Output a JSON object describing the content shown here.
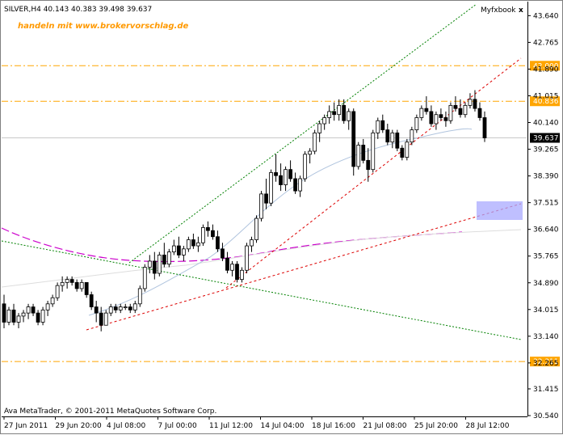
{
  "window": {
    "header": "SILVER,H4  40.143 40.383 39.498 39.637",
    "caption": "Myfxbook",
    "close_label": "x"
  },
  "watermark": "handeln mit www.brokervorschlag.de",
  "footer": "Ava MetaTrader, © 2001-2011 MetaQuotes Software Corp.",
  "chart_data": {
    "type": "candlestick",
    "symbol": "SILVER",
    "timeframe": "H4",
    "ohlc_last": [
      40.143,
      40.383,
      39.498,
      39.637
    ],
    "last_price": "39.637",
    "y_ticks": [
      "43.640",
      "42.765",
      "41.890",
      "41.015",
      "40.140",
      "39.265",
      "38.390",
      "37.515",
      "36.640",
      "35.765",
      "34.890",
      "34.015",
      "33.140",
      "32.265",
      "31.415",
      "30.540"
    ],
    "x_ticks": [
      "27 Jun 2011",
      "29 Jun 20:00",
      "4 Jul 08:00",
      "7 Jul 00:00",
      "11 Jul 12:00",
      "14 Jul 04:00",
      "18 Jul 16:00",
      "21 Jul 08:00",
      "25 Jul 20:00",
      "28 Jul 12:00"
    ],
    "ylim": [
      30.54,
      44.1
    ],
    "horizontal_levels": [
      {
        "value": 42.0,
        "label": "42.000",
        "color": "#ffa500"
      },
      {
        "value": 40.836,
        "label": "40.836",
        "color": "#ffa500"
      },
      {
        "value": 32.311,
        "label": "32.311",
        "color": "#ffa500"
      }
    ],
    "candles": [
      [
        34.2,
        34.5,
        33.4,
        33.6
      ],
      [
        33.6,
        34.1,
        33.5,
        34.0
      ],
      [
        34.0,
        34.2,
        33.5,
        33.6
      ],
      [
        33.6,
        33.9,
        33.4,
        33.8
      ],
      [
        33.8,
        34.0,
        33.6,
        33.9
      ],
      [
        33.9,
        34.2,
        33.7,
        34.1
      ],
      [
        34.1,
        34.2,
        33.8,
        33.9
      ],
      [
        33.9,
        34.0,
        33.5,
        33.6
      ],
      [
        33.6,
        34.1,
        33.5,
        34.0
      ],
      [
        34.0,
        34.3,
        33.8,
        34.2
      ],
      [
        34.2,
        34.5,
        34.1,
        34.4
      ],
      [
        34.4,
        34.9,
        34.3,
        34.8
      ],
      [
        34.8,
        35.1,
        34.6,
        34.9
      ],
      [
        34.9,
        35.1,
        34.7,
        35.0
      ],
      [
        35.0,
        35.1,
        34.8,
        34.9
      ],
      [
        34.9,
        35.0,
        34.6,
        34.7
      ],
      [
        34.7,
        35.0,
        34.6,
        34.9
      ],
      [
        34.9,
        34.9,
        34.4,
        34.5
      ],
      [
        34.5,
        34.6,
        34.0,
        34.1
      ],
      [
        34.1,
        34.3,
        33.6,
        33.9
      ],
      [
        33.9,
        34.1,
        33.3,
        33.5
      ],
      [
        33.5,
        34.0,
        33.5,
        33.9
      ],
      [
        33.9,
        34.2,
        33.8,
        34.1
      ],
      [
        34.1,
        34.2,
        33.9,
        34.0
      ],
      [
        34.0,
        34.2,
        33.9,
        34.1
      ],
      [
        34.1,
        34.2,
        34.0,
        34.1
      ],
      [
        34.1,
        34.2,
        33.9,
        34.0
      ],
      [
        34.0,
        34.3,
        33.9,
        34.2
      ],
      [
        34.2,
        34.8,
        34.1,
        34.7
      ],
      [
        34.7,
        35.5,
        34.6,
        35.4
      ],
      [
        35.4,
        35.8,
        35.2,
        35.6
      ],
      [
        35.6,
        35.9,
        35.0,
        35.2
      ],
      [
        35.2,
        35.9,
        35.1,
        35.8
      ],
      [
        35.8,
        36.2,
        35.4,
        35.5
      ],
      [
        35.5,
        36.0,
        35.4,
        35.9
      ],
      [
        35.9,
        36.3,
        35.8,
        36.1
      ],
      [
        36.1,
        36.4,
        35.7,
        35.8
      ],
      [
        35.8,
        36.1,
        35.6,
        36.0
      ],
      [
        36.0,
        36.4,
        35.9,
        36.3
      ],
      [
        36.3,
        36.5,
        36.0,
        36.1
      ],
      [
        36.1,
        36.4,
        35.9,
        36.2
      ],
      [
        36.2,
        36.8,
        36.1,
        36.7
      ],
      [
        36.7,
        36.9,
        36.4,
        36.6
      ],
      [
        36.6,
        36.8,
        36.3,
        36.4
      ],
      [
        36.4,
        36.6,
        35.9,
        36.0
      ],
      [
        36.0,
        36.2,
        35.6,
        35.7
      ],
      [
        35.7,
        35.9,
        35.2,
        35.3
      ],
      [
        35.3,
        35.6,
        35.1,
        35.5
      ],
      [
        35.5,
        35.6,
        34.9,
        35.0
      ],
      [
        35.0,
        35.4,
        34.9,
        35.3
      ],
      [
        35.3,
        36.2,
        35.2,
        36.1
      ],
      [
        36.1,
        36.4,
        35.9,
        36.3
      ],
      [
        36.3,
        37.1,
        36.2,
        37.0
      ],
      [
        37.0,
        37.9,
        36.9,
        37.8
      ],
      [
        37.8,
        38.3,
        37.3,
        37.5
      ],
      [
        37.5,
        38.6,
        37.4,
        38.5
      ],
      [
        38.5,
        39.1,
        38.2,
        38.4
      ],
      [
        38.4,
        38.8,
        37.9,
        38.1
      ],
      [
        38.1,
        38.7,
        37.9,
        38.6
      ],
      [
        38.6,
        38.9,
        38.2,
        38.3
      ],
      [
        38.3,
        38.5,
        37.8,
        37.9
      ],
      [
        37.9,
        38.4,
        37.7,
        38.3
      ],
      [
        38.3,
        39.2,
        38.2,
        39.1
      ],
      [
        39.1,
        39.3,
        38.8,
        39.2
      ],
      [
        39.2,
        39.9,
        39.1,
        39.8
      ],
      [
        39.8,
        40.2,
        39.5,
        40.1
      ],
      [
        40.1,
        40.4,
        39.9,
        40.3
      ],
      [
        40.3,
        40.7,
        40.1,
        40.5
      ],
      [
        40.5,
        40.8,
        40.2,
        40.4
      ],
      [
        40.4,
        40.9,
        40.2,
        40.7
      ],
      [
        40.7,
        40.9,
        40.1,
        40.2
      ],
      [
        40.2,
        40.6,
        39.9,
        40.5
      ],
      [
        40.5,
        40.6,
        38.4,
        38.7
      ],
      [
        38.7,
        39.5,
        38.6,
        39.4
      ],
      [
        39.4,
        39.6,
        38.8,
        38.9
      ],
      [
        38.9,
        39.3,
        38.2,
        38.6
      ],
      [
        38.6,
        39.9,
        38.5,
        39.8
      ],
      [
        39.8,
        40.3,
        39.6,
        40.2
      ],
      [
        40.2,
        40.4,
        39.8,
        39.9
      ],
      [
        39.9,
        40.1,
        39.4,
        39.5
      ],
      [
        39.5,
        39.9,
        39.3,
        39.8
      ],
      [
        39.8,
        39.9,
        39.2,
        39.3
      ],
      [
        39.3,
        39.4,
        38.9,
        39.0
      ],
      [
        39.0,
        39.6,
        38.9,
        39.5
      ],
      [
        39.5,
        40.0,
        39.4,
        39.9
      ],
      [
        39.9,
        40.4,
        39.8,
        40.3
      ],
      [
        40.3,
        40.7,
        40.2,
        40.6
      ],
      [
        40.6,
        41.0,
        40.4,
        40.5
      ],
      [
        40.5,
        40.7,
        40.0,
        40.1
      ],
      [
        40.1,
        40.5,
        39.9,
        40.4
      ],
      [
        40.4,
        40.6,
        40.2,
        40.3
      ],
      [
        40.3,
        40.5,
        40.0,
        40.2
      ],
      [
        40.2,
        40.8,
        40.1,
        40.7
      ],
      [
        40.7,
        41.0,
        40.5,
        40.6
      ],
      [
        40.6,
        40.9,
        40.3,
        40.4
      ],
      [
        40.4,
        40.8,
        40.3,
        40.7
      ],
      [
        40.7,
        41.1,
        40.6,
        40.9
      ],
      [
        40.9,
        41.2,
        40.5,
        40.6
      ],
      [
        40.6,
        40.8,
        40.2,
        40.3
      ],
      [
        40.3,
        40.5,
        39.5,
        39.637
      ]
    ]
  }
}
